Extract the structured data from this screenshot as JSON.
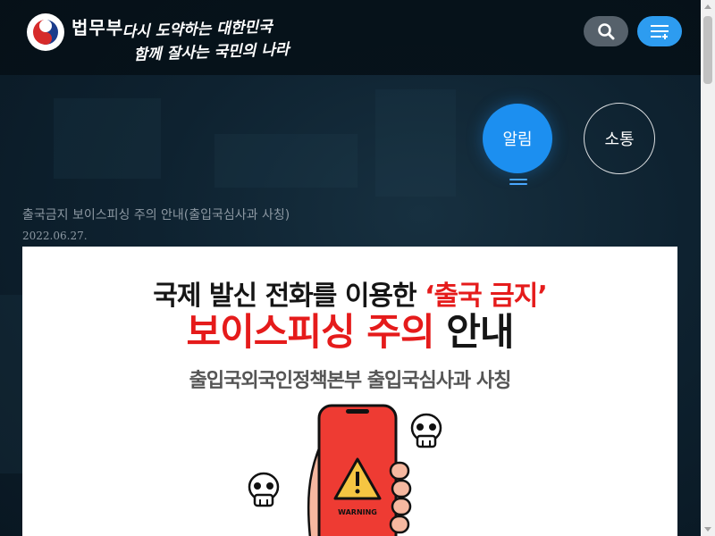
{
  "header": {
    "ministry_name": "법무부",
    "slogan_line1": "다시 도약하는 대한민국",
    "slogan_line2": "함께 잘사는 국민의 나라",
    "icons": {
      "logo": "taegeuk-emblem-icon",
      "search": "search-icon",
      "menu": "menu-plus-icon"
    }
  },
  "tabs": [
    {
      "label": "알림",
      "active": true
    },
    {
      "label": "소통",
      "active": false
    }
  ],
  "article": {
    "title": "출국금지 보이스피싱 주의 안내(출입국심사과 사칭)",
    "date": "2022.06.27."
  },
  "poster": {
    "line1_prefix": "국제 발신 전화를 이용한",
    "line1_quote": "‘출국 금지’",
    "line2_red": "보이스피싱 주의",
    "line2_dark": "안내",
    "line3": "출입국외국인정책본부 출입국심사과 사칭",
    "warning_text": "WARNING",
    "icons": [
      "skull-icon",
      "phone-icon",
      "warning-triangle-icon",
      "skull-icon"
    ]
  },
  "colors": {
    "accent_blue": "#1c8ff0",
    "warning_red": "#e51b1b",
    "header_bg": "#0b1a26"
  }
}
